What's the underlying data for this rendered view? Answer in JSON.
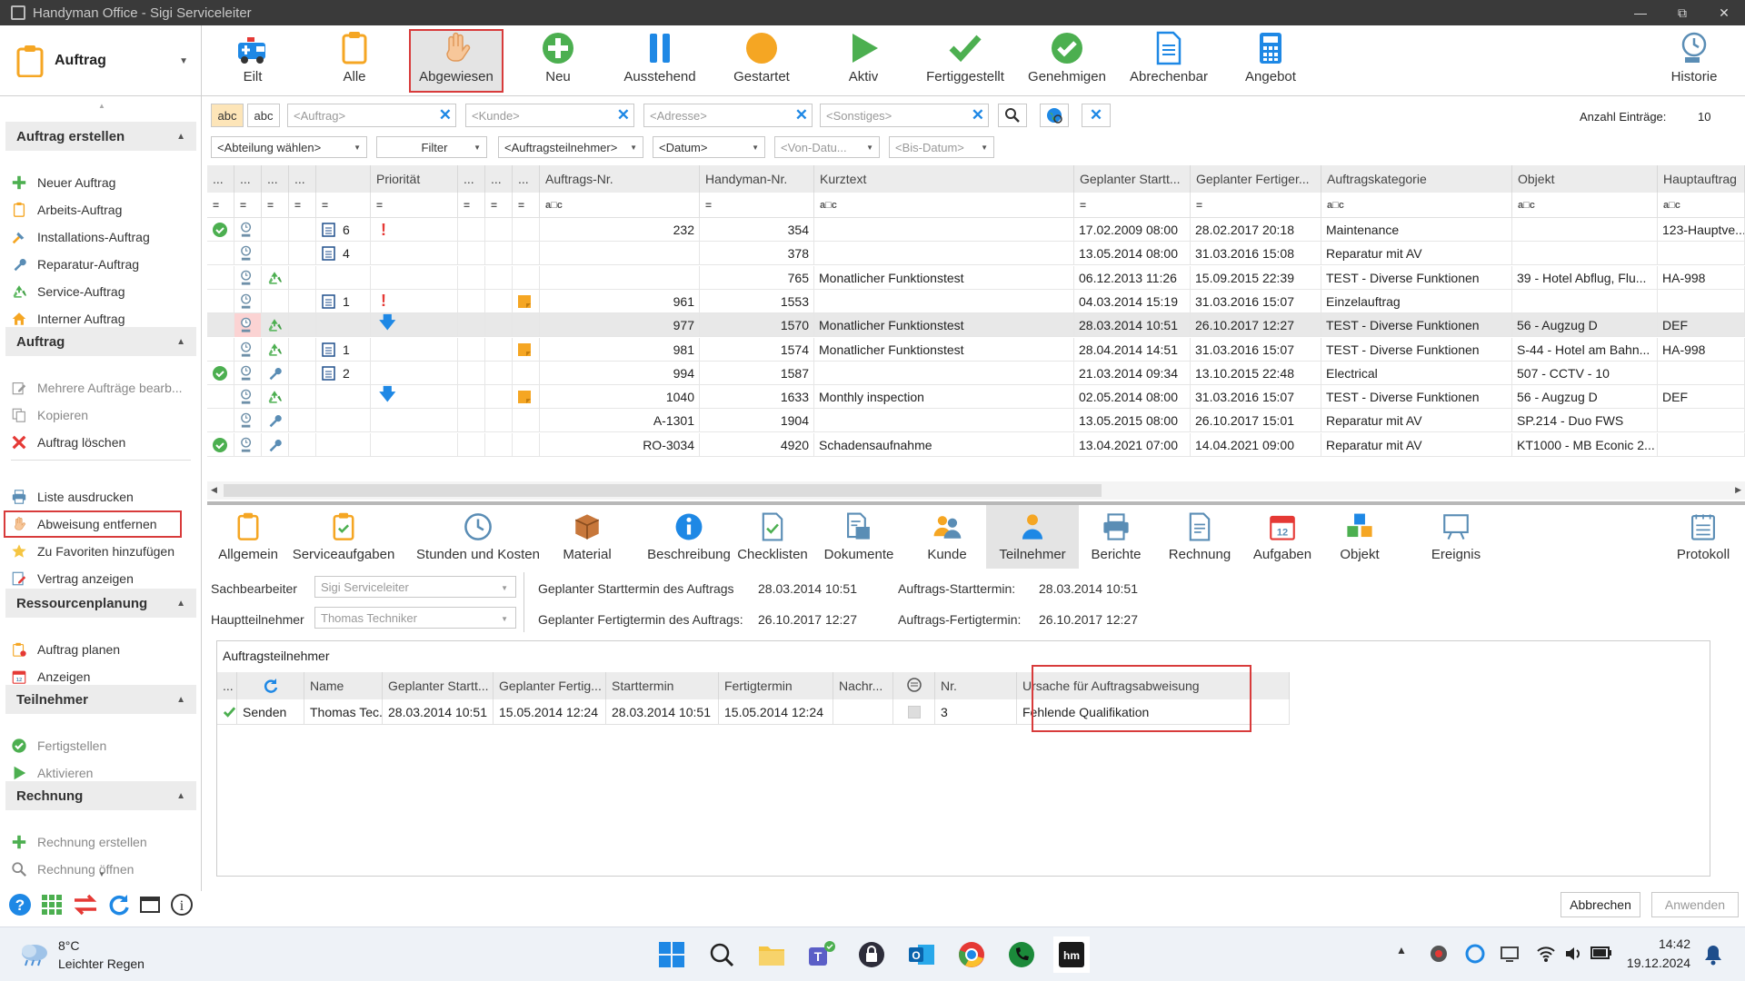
{
  "window": {
    "title": "Handyman Office - Sigi Serviceleiter"
  },
  "mode": {
    "label": "Auftrag"
  },
  "ribbon": [
    {
      "label": "Eilt",
      "icon": "ambulance-icon"
    },
    {
      "label": "Alle",
      "icon": "clipboard-icon"
    },
    {
      "label": "Abgewiesen",
      "icon": "hand-icon",
      "selected": true
    },
    {
      "label": "Neu",
      "icon": "plus-circle-icon"
    },
    {
      "label": "Ausstehend",
      "icon": "pause-icon"
    },
    {
      "label": "Gestartet",
      "icon": "orange-circle-icon"
    },
    {
      "label": "Aktiv",
      "icon": "play-icon"
    },
    {
      "label": "Fertiggestellt",
      "icon": "check-icon"
    },
    {
      "label": "Genehmigen",
      "icon": "check-circle-icon"
    },
    {
      "label": "Abrechenbar",
      "icon": "document-icon"
    },
    {
      "label": "Angebot",
      "icon": "calculator-icon"
    },
    {
      "label": "Historie",
      "icon": "history-icon"
    }
  ],
  "sidebar": {
    "sections": [
      {
        "title": "Auftrag erstellen",
        "items": [
          {
            "label": "Neuer Auftrag",
            "icon": "plus-icon"
          },
          {
            "label": "Arbeits-Auftrag",
            "icon": "clipboard-icon"
          },
          {
            "label": "Installations-Auftrag",
            "icon": "hammer-icon"
          },
          {
            "label": "Reparatur-Auftrag",
            "icon": "wrench-icon"
          },
          {
            "label": "Service-Auftrag",
            "icon": "recycle-icon"
          },
          {
            "label": "Interner Auftrag",
            "icon": "house-icon"
          }
        ]
      },
      {
        "title": "Auftrag",
        "items": [
          {
            "label": "Mehrere Aufträge bearb...",
            "icon": "edit-icon",
            "disabled": true
          },
          {
            "label": "Kopieren",
            "icon": "copy-icon",
            "disabled": true
          },
          {
            "label": "Auftrag löschen",
            "icon": "delete-icon"
          },
          {
            "label": "Liste ausdrucken",
            "icon": "printer-icon"
          },
          {
            "label": "Abweisung entfernen",
            "icon": "hand-icon",
            "highlight": true
          },
          {
            "label": "Zu Favoriten hinzufügen",
            "icon": "star-icon"
          },
          {
            "label": "Vertrag anzeigen",
            "icon": "contract-icon"
          }
        ]
      },
      {
        "title": "Ressourcenplanung",
        "items": [
          {
            "label": "Auftrag planen",
            "icon": "plan-icon"
          },
          {
            "label": "Anzeigen",
            "icon": "calendar-icon"
          }
        ]
      },
      {
        "title": "Teilnehmer",
        "items": [
          {
            "label": "Fertigstellen",
            "icon": "check-circle-icon",
            "disabled": true
          },
          {
            "label": "Aktivieren",
            "icon": "play-icon",
            "disabled": true
          }
        ]
      },
      {
        "title": "Rechnung",
        "items": [
          {
            "label": "Rechnung erstellen",
            "icon": "plus-icon",
            "disabled": true
          },
          {
            "label": "Rechnung öffnen",
            "icon": "search-icon",
            "disabled": true
          }
        ]
      }
    ]
  },
  "filters": {
    "abc1": "abc",
    "abc2": "abc",
    "auftrag": "<Auftrag>",
    "kunde": "<Kunde>",
    "adresse": "<Adresse>",
    "sonstiges": "<Sonstiges>",
    "count_label": "Anzahl Einträge:",
    "count_value": "10",
    "abteilung": "<Abteilung wählen>",
    "filter": "Filter",
    "teilnehmer": "<Auftragsteilnehmer>",
    "datum": "<Datum>",
    "von": "<Von-Datu...",
    "bis": "<Bis-Datum>"
  },
  "grid": {
    "columns": [
      "...",
      "...",
      "...",
      "...",
      "",
      "Priorität",
      "...",
      "...",
      "...",
      "Auftrags-Nr.",
      "Handyman-Nr.",
      "Kurztext",
      "Geplanter Startt...",
      "Geplanter Fertiger...",
      "Auftragskategorie",
      "Objekt",
      "Hauptauftrag"
    ],
    "rows": [
      {
        "status": "ok",
        "doc": "6",
        "prio": "!",
        "flag": "",
        "auftrag": "232",
        "hm": "354",
        "kurz": "",
        "start": "17.02.2009 08:00",
        "fertig": "28.02.2017 20:18",
        "kat": "Maintenance",
        "objekt": "",
        "haupt": "123-Hauptve...",
        "type": ""
      },
      {
        "status": "",
        "doc": "4",
        "prio": "",
        "flag": "",
        "auftrag": "",
        "hm": "378",
        "kurz": "",
        "start": "13.05.2014 08:00",
        "fertig": "31.03.2016 15:08",
        "kat": "Reparatur mit AV",
        "objekt": "",
        "haupt": "",
        "type": ""
      },
      {
        "status": "",
        "doc": "",
        "prio": "",
        "flag": "",
        "auftrag": "",
        "hm": "765",
        "kurz": "Monatlicher Funktionstest",
        "start": "06.12.2013 11:26",
        "fertig": "15.09.2015 22:39",
        "kat": "TEST - Diverse Funktionen",
        "objekt": "39 - Hotel Abflug, Flu...",
        "haupt": "HA-998",
        "type": "recycle"
      },
      {
        "status": "",
        "doc": "1",
        "prio": "!",
        "flag": "note",
        "auftrag": "961",
        "hm": "1553",
        "kurz": "",
        "start": "04.03.2014 15:19",
        "fertig": "31.03.2016 15:07",
        "kat": "Einzelauftrag",
        "objekt": "",
        "haupt": "",
        "type": ""
      },
      {
        "status": "",
        "doc": "",
        "prio": "down",
        "flag": "",
        "auftrag": "977",
        "hm": "1570",
        "kurz": "Monatlicher Funktionstest",
        "start": "28.03.2014 10:51",
        "fertig": "26.10.2017 12:27",
        "kat": "TEST - Diverse Funktionen",
        "objekt": "56 - Augzug D",
        "haupt": "DEF",
        "type": "recycle",
        "selected": true
      },
      {
        "status": "",
        "doc": "1",
        "prio": "",
        "flag": "note",
        "auftrag": "981",
        "hm": "1574",
        "kurz": "Monatlicher Funktionstest",
        "start": "28.04.2014 14:51",
        "fertig": "31.03.2016 15:07",
        "kat": "TEST - Diverse Funktionen",
        "objekt": "S-44 - Hotel am Bahn...",
        "haupt": "HA-998",
        "type": "recycle"
      },
      {
        "status": "ok",
        "doc": "2",
        "prio": "",
        "flag": "",
        "auftrag": "994",
        "hm": "1587",
        "kurz": "",
        "start": "21.03.2014 09:34",
        "fertig": "13.10.2015 22:48",
        "kat": "Electrical",
        "objekt": "507 - CCTV - 10",
        "haupt": "",
        "type": "wrench"
      },
      {
        "status": "",
        "doc": "",
        "prio": "down",
        "flag": "note",
        "auftrag": "1040",
        "hm": "1633",
        "kurz": "Monthly inspection",
        "start": "02.05.2014 08:00",
        "fertig": "31.03.2016 15:07",
        "kat": "TEST - Diverse Funktionen",
        "objekt": "56 - Augzug D",
        "haupt": "DEF",
        "type": "recycle"
      },
      {
        "status": "",
        "doc": "",
        "prio": "",
        "flag": "",
        "auftrag": "A-1301",
        "hm": "1904",
        "kurz": "",
        "start": "13.05.2015 08:00",
        "fertig": "26.10.2017 15:01",
        "kat": "Reparatur mit AV",
        "objekt": "SP.214 - Duo FWS",
        "haupt": "",
        "type": "wrench"
      },
      {
        "status": "ok",
        "doc": "",
        "prio": "",
        "flag": "",
        "auftrag": "RO-3034",
        "hm": "4920",
        "kurz": "Schadensaufnahme",
        "start": "13.04.2021 07:00",
        "fertig": "14.04.2021 09:00",
        "kat": "Reparatur mit AV",
        "objekt": "KT1000 - MB Econic 2...",
        "haupt": "",
        "type": "wrench"
      }
    ]
  },
  "detail_tabs": [
    {
      "label": "Allgemein",
      "icon": "clipboard-icon"
    },
    {
      "label": "Serviceaufgaben",
      "icon": "task-clipboard-icon"
    },
    {
      "label": "Stunden und Kosten",
      "icon": "clock-icon"
    },
    {
      "label": "Material",
      "icon": "box-icon"
    },
    {
      "label": "Beschreibung",
      "icon": "info-icon"
    },
    {
      "label": "Checklisten",
      "icon": "checklist-icon"
    },
    {
      "label": "Dokumente",
      "icon": "documents-icon"
    },
    {
      "label": "Kunde",
      "icon": "customer-icon"
    },
    {
      "label": "Teilnehmer",
      "icon": "participant-icon",
      "selected": true
    },
    {
      "label": "Berichte",
      "icon": "printer-icon"
    },
    {
      "label": "Rechnung",
      "icon": "invoice-icon"
    },
    {
      "label": "Aufgaben",
      "icon": "calendar-icon"
    },
    {
      "label": "Objekt",
      "icon": "cubes-icon"
    },
    {
      "label": "Ereignis",
      "icon": "event-icon"
    },
    {
      "label": "Protokoll",
      "icon": "log-icon"
    }
  ],
  "detail": {
    "sachbearbeiter_label": "Sachbearbeiter",
    "sachbearbeiter": "Sigi Serviceleiter",
    "hauptteilnehmer_label": "Hauptteilnehmer",
    "hauptteilnehmer": "Thomas Techniker",
    "gst_label": "Geplanter Starttermin des Auftrags",
    "gst": "28.03.2014 10:51",
    "gft_label": "Geplanter Fertigtermin des Auftrags:",
    "gft": "26.10.2017 12:27",
    "ast_label": "Auftrags-Starttermin:",
    "ast": "28.03.2014 10:51",
    "aft_label": "Auftrags-Fertigtermin:",
    "aft": "26.10.2017 12:27"
  },
  "participants": {
    "title": "Auftragsteilnehmer",
    "columns": [
      "...",
      "",
      "Name",
      "Geplanter Startt...",
      "Geplanter Fertig...",
      "Starttermin",
      "Fertigtermin",
      "Nachr...",
      "",
      "Nr.",
      "Ursache für Auftragsabweisung"
    ],
    "row": {
      "status": "Senden",
      "name": "Thomas Tec...",
      "gstart": "28.03.2014 10:51",
      "gfertig": "15.05.2014 12:24",
      "start": "28.03.2014 10:51",
      "fertig": "15.05.2014 12:24",
      "nachr": "",
      "nr": "3",
      "ursache": "Fehlende Qualifikation"
    }
  },
  "buttons": {
    "cancel": "Abbrechen",
    "apply": "Anwenden"
  },
  "taskbar": {
    "temp": "8°C",
    "weather": "Leichter Regen",
    "time": "14:42",
    "date": "19.12.2024"
  },
  "colors": {
    "accent": "#1e88e5",
    "green": "#4caf50",
    "highlight": "#d83b3b",
    "orange": "#f5a623"
  }
}
